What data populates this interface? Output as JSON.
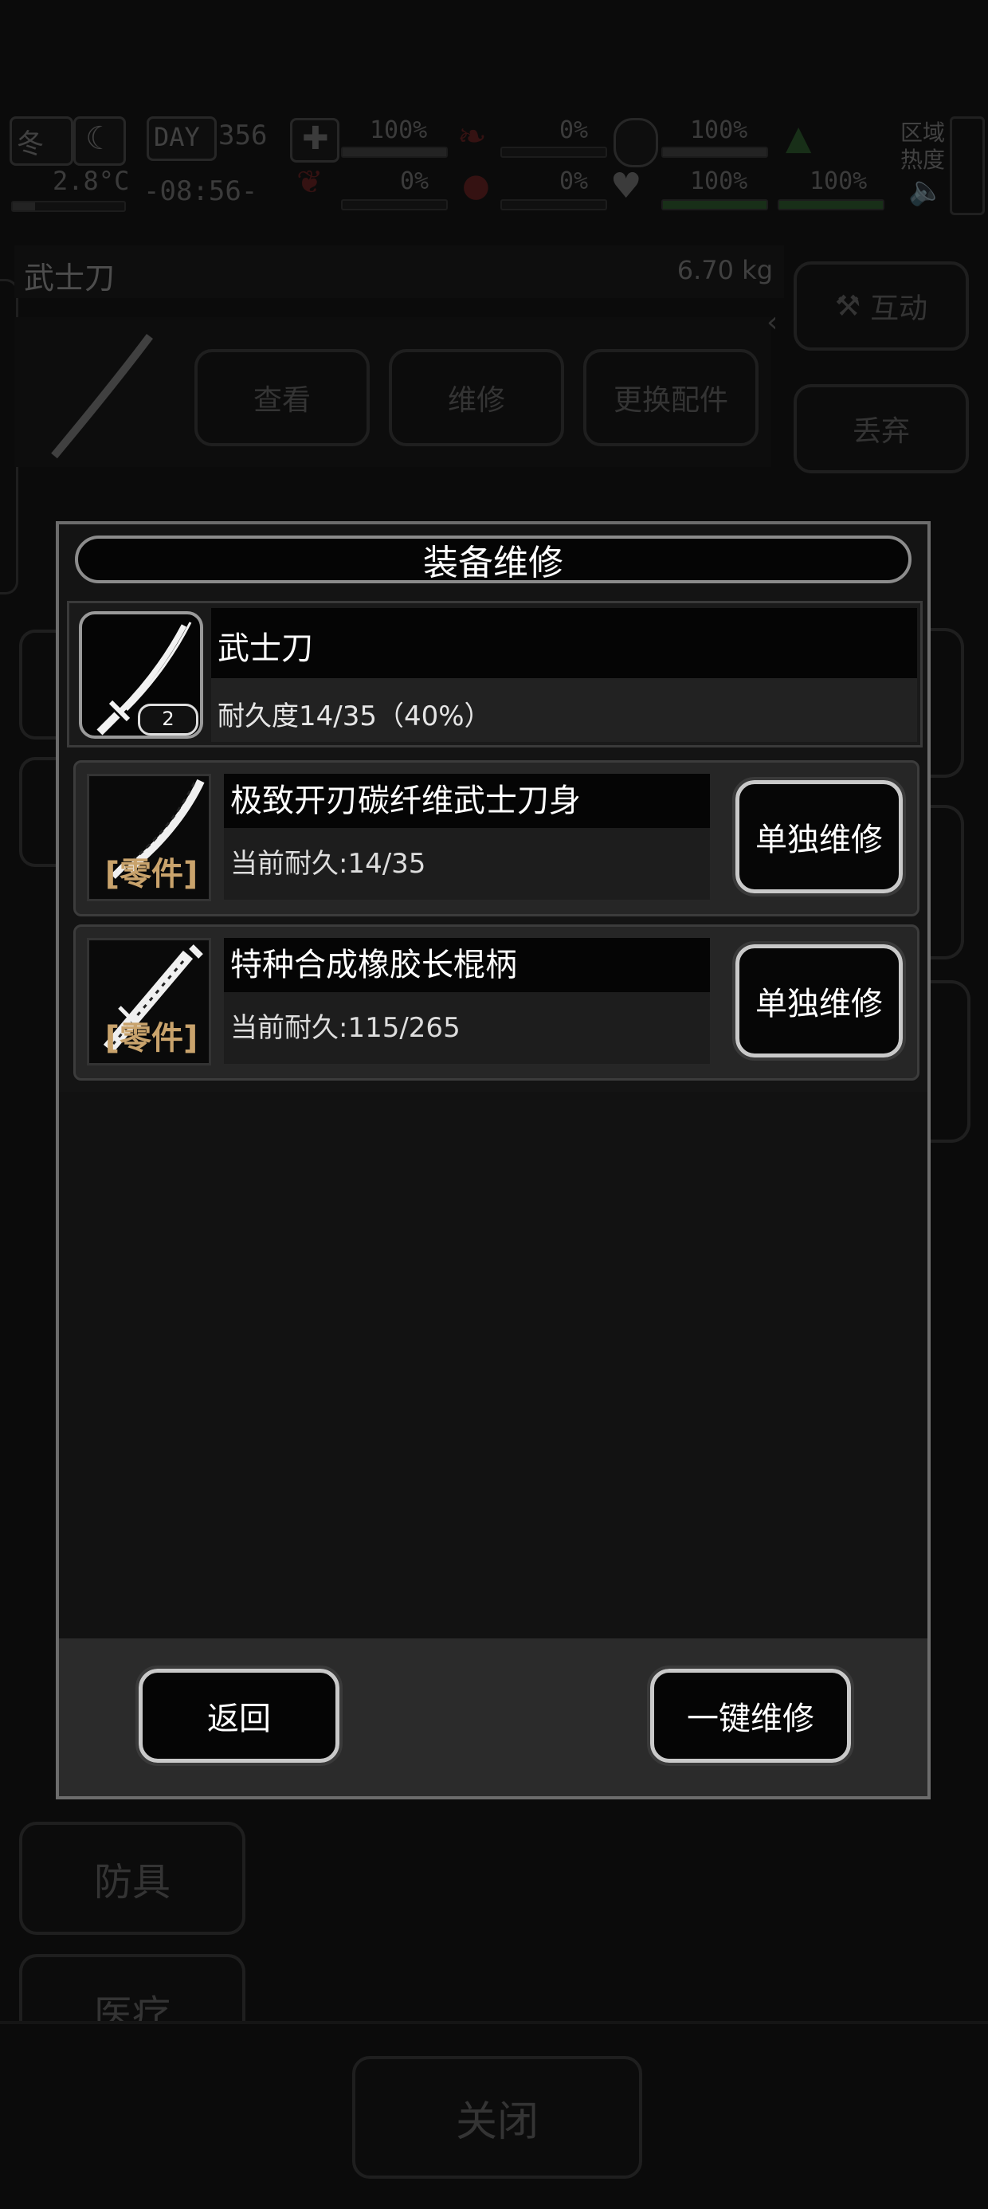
{
  "status": {
    "season": "冬",
    "day_label": "DAY",
    "day_value": "356",
    "temperature": "2.8°C",
    "clock": "-08:56-",
    "health_pct": "100%",
    "hunger_pct": "0%",
    "stamina_pct": "100%",
    "bleed_pct": "0%",
    "blood_pct": "0%",
    "heart_pct": "100%",
    "energy_pct": "100%",
    "zone_heat_label": "区域\n热度"
  },
  "background": {
    "item_name": "武士刀",
    "item_weight": "6.70 kg",
    "view_label": "查看",
    "repair_label": "维修",
    "swap_parts_label": "更换配件",
    "interact_label": "互动",
    "discard_label": "丢弃",
    "armor_label": "防具",
    "medical_label": "医疗",
    "close_label": "关闭"
  },
  "dialog": {
    "title": "装备维修",
    "item": {
      "name": "武士刀",
      "count": "2",
      "durability_text": "耐久度14/35（40%）"
    },
    "parts": [
      {
        "name": "极致开刃碳纤维武士刀身",
        "durability": "当前耐久:14/35",
        "tag": "零件",
        "repair_label": "单独维修"
      },
      {
        "name": "特种合成橡胶长棍柄",
        "durability": "当前耐久:115/265",
        "tag": "零件",
        "repair_label": "单独维修"
      }
    ],
    "back_label": "返回",
    "repair_all_label": "一键维修"
  }
}
